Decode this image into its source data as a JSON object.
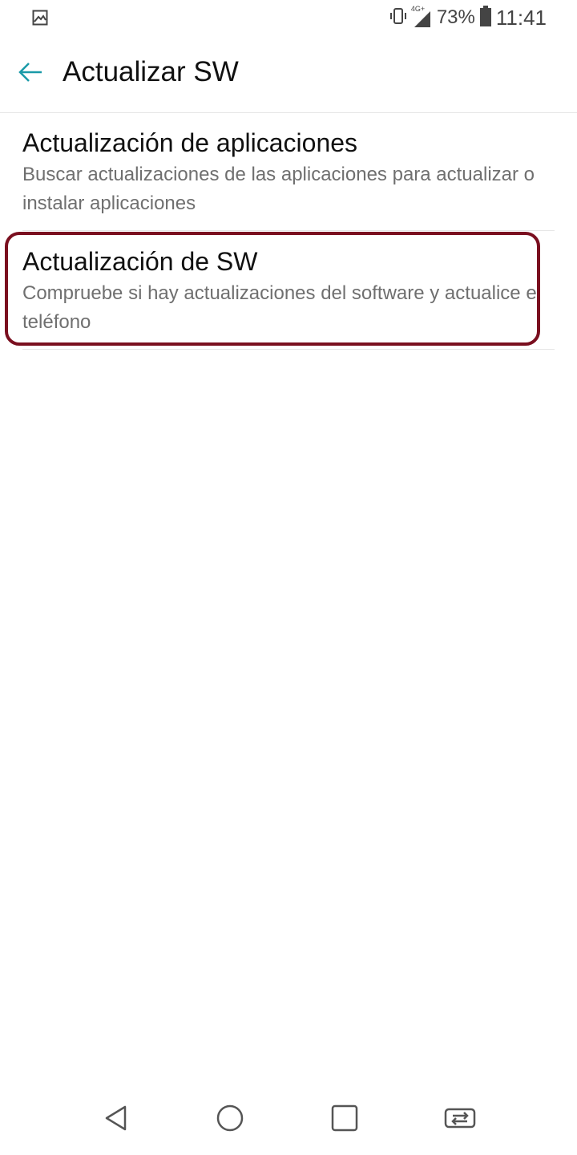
{
  "status_bar": {
    "notification_icon": "gallery-icon",
    "vibrate_icon": "vibrate-icon",
    "network_label": "4G+",
    "signal_icon": "signal-icon",
    "battery_percent": "73%",
    "battery_icon": "battery-icon",
    "time": "11:41"
  },
  "app_bar": {
    "back_icon": "arrow-left-icon",
    "title": "Actualizar SW",
    "accent_color": "#1a9aa8"
  },
  "list": {
    "items": [
      {
        "title": "Actualización de aplicaciones",
        "subtitle": "Buscar actualizaciones de las aplicaciones para actualizar o instalar aplicaciones"
      },
      {
        "title": "Actualización de SW",
        "subtitle": "Compruebe si hay actualizaciones del software y actualice el teléfono",
        "highlighted": true
      }
    ]
  },
  "highlight_color": "#7a0f1f",
  "nav_bar": {
    "back_icon": "triangle-back-icon",
    "home_icon": "circle-home-icon",
    "recents_icon": "square-recents-icon",
    "switch_icon": "dual-window-icon"
  }
}
